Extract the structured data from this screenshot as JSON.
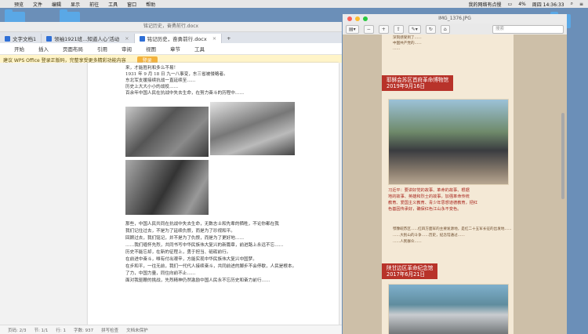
{
  "menubar": {
    "items": [
      "预览",
      "文件",
      "编辑",
      "显示",
      "前往",
      "工具",
      "窗口",
      "帮助"
    ],
    "wifi": "我的网络有点慢",
    "battery": "4%",
    "clock": "周四 14:36:33"
  },
  "wps": {
    "window_title": "铭记历史，奋勇前行.docx",
    "tabs": [
      {
        "label": "文字文档1"
      },
      {
        "label": "领袖1921班...知道人心'活动"
      },
      {
        "label": "铭记历史，奋勇前行.docx"
      }
    ],
    "ribbon": [
      "开始",
      "插入",
      "页面布局",
      "引用",
      "审阅",
      "视图",
      "章节",
      "工具"
    ],
    "ribbon_active": "开始",
    "notice_text": "建议 WPS Office 登录正版码，完整享受更多精彩功能内容",
    "notice_button": "登录",
    "para_top": [
      "来，才能胜利和多么不易！",
      "1931 年 9 月 18 日 九一八事变，东三省被侵略者。",
      "东北军支援接续抗战一直延续至……",
      "历史上大大小小的战役……",
      "百余年中国人民在抗战中失去生命，在努力奋斗的历程中……"
    ],
    "para_bottom": [
      "那些，中国人民共同在抗战中失去生命，无数志士和先辈的牺牲，不论你都在我",
      "我们记住过去，不是为了延续仇恨，而是为了珍视和平。",
      "回顾过去，我们铭记，并不是为了仇恨，而是为了更好地……",
      "……我们缅怀先烈，共同书写中华民族伟大复兴的新篇章，前进路上永远不忘……",
      "历史不能忘却，在新的征程上，勇于担当、砥砺前行。",
      "在前进中奋斗，唯有付出艰辛，方能实现中华民族伟大复兴中国梦。",
      "在步和平，一往无前，我们一代代人接续奋斗，共同前进的脚步不会停歇，人民是根本。",
      "了力，中国力量，同住向前不止……",
      "面对我驱鞭的挑战，先烈精神仍然激励中国人民永不忘历史和奋力前行……"
    ],
    "status": {
      "page": "页码: 2/3",
      "section": "节: 1/1",
      "line": "行: 1",
      "words": "字数: 937",
      "spell": "拼写检查",
      "protect": "文档未保护"
    }
  },
  "preview": {
    "title": "IMG_1376.JPG",
    "search_placeholder": "搜索",
    "top_text": [
      "深刻感受到了……",
      "中国共产党的……",
      "……"
    ],
    "banner1_line1": "耶稣会苏区首府革命博物馆",
    "banner1_line2": "2019年9月16日",
    "quote_lines": [
      "习近平：要讲好党的故事、革命的故事、根据",
      "地的故事、英雄和烈士的故事，加强革命传统",
      "教育、爱国主义教育、青少年思想道德教育，把红",
      "色基因传承好，确保红色江山永不变色。"
    ],
    "mid_text": [
      "鄂豫皖苏区……红四方面军的主要发源地，是红二十五军长征的出发地……",
      "……大别山的斗争……历史，纪念馆通过……",
      "……人民群众……"
    ],
    "banner2_line1": "陕甘边区革命纪念馆",
    "banner2_line2": "2017年6月21日"
  },
  "colors": {
    "banner": "#b8332a",
    "quote": "#a8261d",
    "ribbon_active": "#1a73e8",
    "notice_button": "#f3b33d"
  }
}
